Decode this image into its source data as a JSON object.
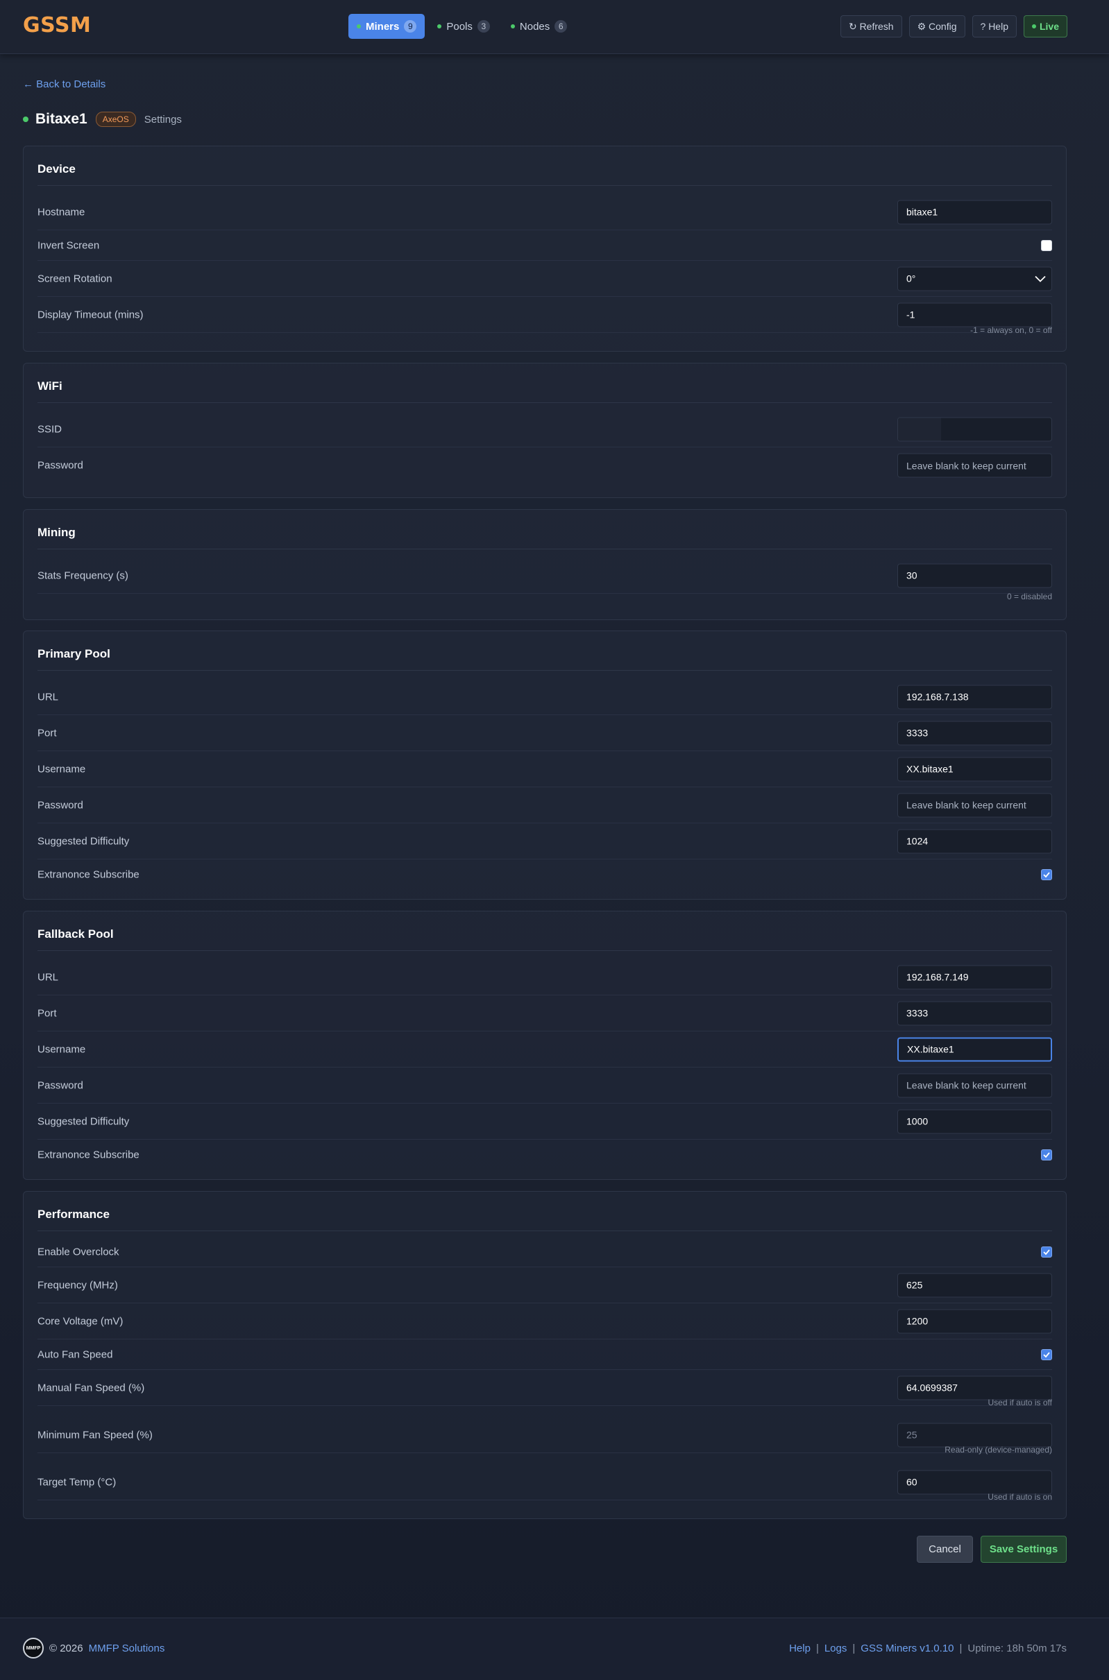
{
  "header": {
    "logo": "GSSM",
    "tabs": [
      {
        "label": "Miners",
        "count": "9"
      },
      {
        "label": "Pools",
        "count": "3"
      },
      {
        "label": "Nodes",
        "count": "6"
      }
    ],
    "actions": {
      "refresh": "↻ Refresh",
      "config": "⚙ Config",
      "help": "? Help",
      "live": "Live"
    }
  },
  "page": {
    "back_link": "← Back to Details",
    "miner_name": "Bitaxe1",
    "os_badge": "AxeOS",
    "subtitle": "Settings"
  },
  "device": {
    "title": "Device",
    "hostname_label": "Hostname",
    "hostname_value": "bitaxe1",
    "invert_label": "Invert Screen",
    "invert_checked": false,
    "rotation_label": "Screen Rotation",
    "rotation_value": "0°",
    "timeout_label": "Display Timeout (mins)",
    "timeout_value": "-1",
    "timeout_hint": "-1 = always on, 0 = off"
  },
  "wifi": {
    "title": "WiFi",
    "ssid_label": "SSID",
    "ssid_value": "",
    "password_label": "Password",
    "password_placeholder": "Leave blank to keep current"
  },
  "mining": {
    "title": "Mining",
    "stats_label": "Stats Frequency (s)",
    "stats_value": "30",
    "stats_hint": "0 = disabled"
  },
  "primary_pool": {
    "title": "Primary Pool",
    "url_label": "URL",
    "url_value": "192.168.7.138",
    "port_label": "Port",
    "port_value": "3333",
    "username_label": "Username",
    "username_value": "XX.bitaxe1",
    "password_label": "Password",
    "password_placeholder": "Leave blank to keep current",
    "difficulty_label": "Suggested Difficulty",
    "difficulty_value": "1024",
    "extranonce_label": "Extranonce Subscribe",
    "extranonce_checked": true
  },
  "fallback_pool": {
    "title": "Fallback Pool",
    "url_label": "URL",
    "url_value": "192.168.7.149",
    "port_label": "Port",
    "port_value": "3333",
    "username_label": "Username",
    "username_value": "XX.bitaxe1",
    "password_label": "Password",
    "password_placeholder": "Leave blank to keep current",
    "difficulty_label": "Suggested Difficulty",
    "difficulty_value": "1000",
    "extranonce_label": "Extranonce Subscribe",
    "extranonce_checked": true
  },
  "performance": {
    "title": "Performance",
    "overclock_label": "Enable Overclock",
    "overclock_checked": true,
    "frequency_label": "Frequency (MHz)",
    "frequency_value": "625",
    "voltage_label": "Core Voltage (mV)",
    "voltage_value": "1200",
    "autofan_label": "Auto Fan Speed",
    "autofan_checked": true,
    "manualfan_label": "Manual Fan Speed (%)",
    "manualfan_value": "64.0699387",
    "manualfan_hint": "Used if auto is off",
    "minfan_label": "Minimum Fan Speed (%)",
    "minfan_value": "25",
    "minfan_hint": "Read-only (device-managed)",
    "temp_label": "Target Temp (°C)",
    "temp_value": "60",
    "temp_hint": "Used if auto is on"
  },
  "buttons": {
    "cancel": "Cancel",
    "save": "Save Settings"
  },
  "footer": {
    "logo_text": "MMFP",
    "copyright": "© 2026",
    "company": "MMFP Solutions",
    "help": "Help",
    "logs": "Logs",
    "version": "GSS Miners v1.0.10",
    "sep": "|",
    "uptime": "Uptime: 18h 50m 17s"
  },
  "colors": {
    "accent": "#4a84e8",
    "logo": "#f3a04a",
    "live": "#6ee08a",
    "status_dot": "#4cc96a"
  }
}
